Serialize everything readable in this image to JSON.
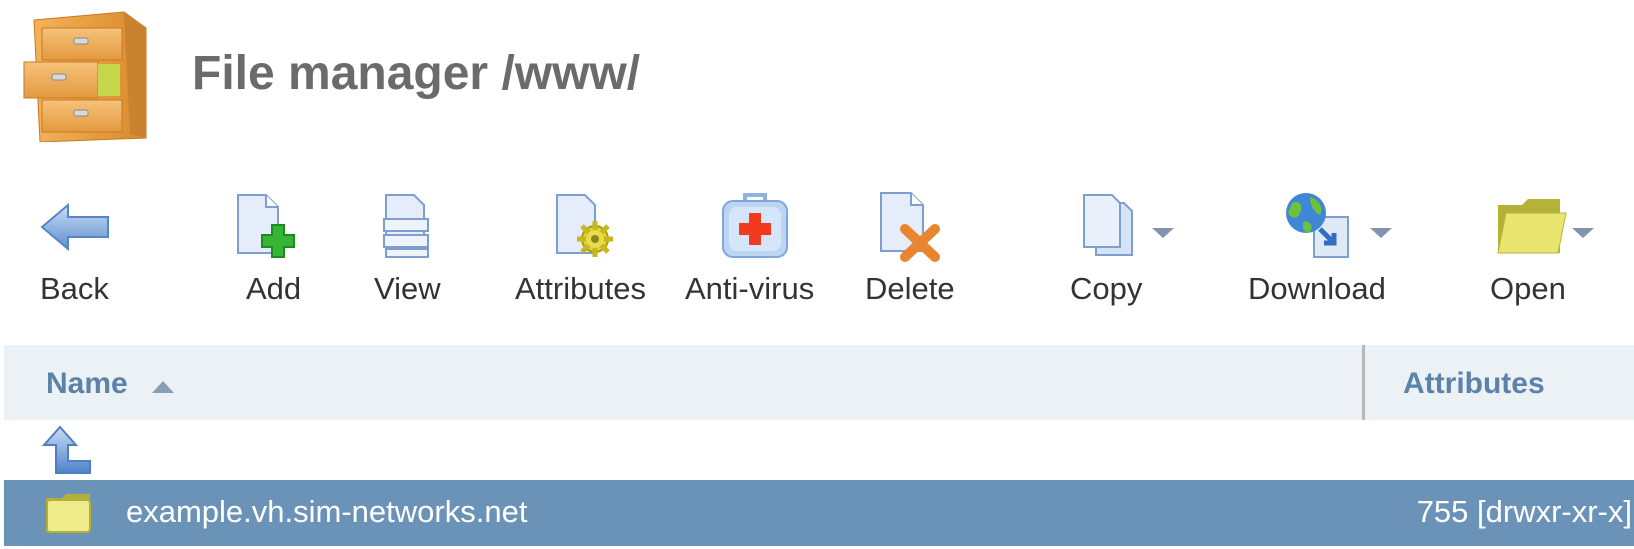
{
  "header": {
    "title": "File manager /www/",
    "icon": "file-cabinet-icon"
  },
  "toolbar": {
    "buttons": [
      {
        "id": "back",
        "label": "Back",
        "icon": "back-arrow-icon",
        "has_dropdown": false
      },
      {
        "id": "add",
        "label": "Add",
        "icon": "add-file-icon",
        "has_dropdown": false
      },
      {
        "id": "view",
        "label": "View",
        "icon": "view-file-icon",
        "has_dropdown": false
      },
      {
        "id": "attributes",
        "label": "Attributes",
        "icon": "file-attributes-icon",
        "has_dropdown": false
      },
      {
        "id": "antivirus",
        "label": "Anti-virus",
        "icon": "first-aid-kit-icon",
        "has_dropdown": false
      },
      {
        "id": "delete",
        "label": "Delete",
        "icon": "delete-file-icon",
        "has_dropdown": false
      },
      {
        "id": "copy",
        "label": "Copy",
        "icon": "copy-icon",
        "has_dropdown": true
      },
      {
        "id": "download",
        "label": "Download",
        "icon": "globe-download-icon",
        "has_dropdown": true
      },
      {
        "id": "open",
        "label": "Open",
        "icon": "open-folder-icon",
        "has_dropdown": true
      }
    ]
  },
  "table": {
    "columns": [
      {
        "label": "Name",
        "sort": "ascending"
      },
      {
        "label": "Attributes"
      }
    ],
    "rows": [
      {
        "type": "parent-directory",
        "icon": "up-directory-icon",
        "name": "",
        "attributes": ""
      },
      {
        "type": "folder",
        "icon": "folder-icon",
        "name": "example.vh.sim-networks.net",
        "attributes": "755 [drwxr-xr-x]",
        "selected": true
      }
    ]
  },
  "colors": {
    "title": "#6b6b6b",
    "header_bg": "#ecf1f6",
    "header_text": "#5b82a9",
    "selected_row": "#6b93b8",
    "label_text": "#333333"
  }
}
